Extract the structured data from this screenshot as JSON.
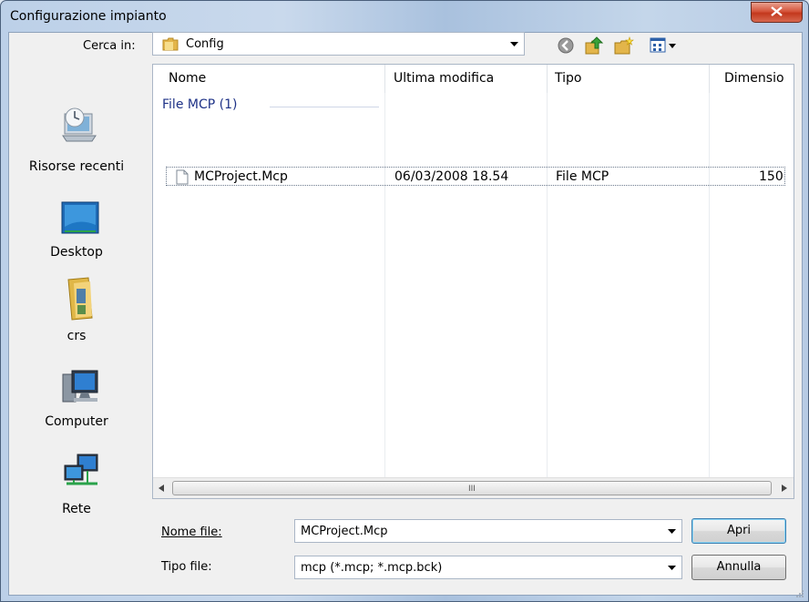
{
  "window": {
    "title": "Configurazione impianto"
  },
  "lookin": {
    "label": "Cerca in:",
    "value": "Config"
  },
  "places": [
    {
      "label": "Risorse recenti",
      "icon": "recent-places-icon"
    },
    {
      "label": "Desktop",
      "icon": "desktop-icon"
    },
    {
      "label": "crs",
      "icon": "user-folder-icon"
    },
    {
      "label": "Computer",
      "icon": "computer-icon"
    },
    {
      "label": "Rete",
      "icon": "network-icon"
    }
  ],
  "columns": [
    "Nome",
    "Ultima modifica",
    "Tipo",
    "Dimensio"
  ],
  "group": {
    "label": "File MCP (1)"
  },
  "files": [
    {
      "name": "MCProject.Mcp",
      "modified": "06/03/2008 18.54",
      "type": "File MCP",
      "size": "150"
    }
  ],
  "scrollbar": {
    "grip": "III"
  },
  "filename": {
    "label": "Nome file:",
    "value": "MCProject.Mcp"
  },
  "filetype": {
    "label": "Tipo file:",
    "value": "mcp (*.mcp; *.mcp.bck)"
  },
  "buttons": {
    "open": "Apri",
    "cancel": "Annulla"
  }
}
